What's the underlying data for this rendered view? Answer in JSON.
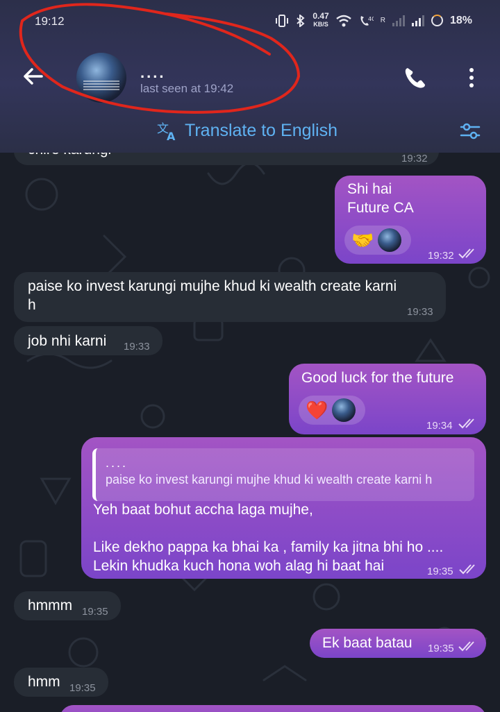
{
  "status_bar": {
    "time": "19:12",
    "speed_value": "0.47",
    "speed_unit": "KB/S",
    "battery": "18%",
    "sim_label": "R"
  },
  "header": {
    "contact_name": "....",
    "last_seen": "last seen at 19:42",
    "back_icon": "arrow-left-icon",
    "call_icon": "phone-icon",
    "menu_icon": "more-vertical-icon"
  },
  "translate": {
    "label": "Translate to English",
    "icon": "translate-icon",
    "settings_icon": "sliders-icon"
  },
  "messages": {
    "m0": {
      "text": "chire karungi",
      "time": "19:32"
    },
    "m1": {
      "line1": "Shi hai",
      "line2": "Future CA",
      "reaction": "🤝",
      "time": "19:32"
    },
    "m2": {
      "line1": "paise ko invest karungi mujhe khud ki wealth create karni",
      "line2": "h",
      "time": "19:33"
    },
    "m3": {
      "text": "job nhi karni",
      "time": "19:33"
    },
    "m4": {
      "text": "Good luck for the future",
      "reaction": "❤️",
      "time": "19:34"
    },
    "m5": {
      "quote_name": "....",
      "quote_text": "paise ko invest karungi mujhe khud ki wealth create karni h",
      "line1": "Yeh baat bohut accha laga mujhe,",
      "line2": "Like dekho pappa ka bhai ka , family ka jitna bhi ho ....",
      "line3": "Lekin khudka kuch hona woh alag hi baat hai",
      "time": "19:35"
    },
    "m6": {
      "text": "hmmm",
      "time": "19:35"
    },
    "m7": {
      "text": "Ek baat batau",
      "time": "19:35"
    },
    "m8": {
      "text": "hmm",
      "time": "19:35"
    }
  },
  "colors": {
    "outgoing_bubble": "#8a4cc8",
    "incoming_bubble": "#272d36",
    "accent_link": "#5fb2f2",
    "annotation": "#e0261c"
  }
}
